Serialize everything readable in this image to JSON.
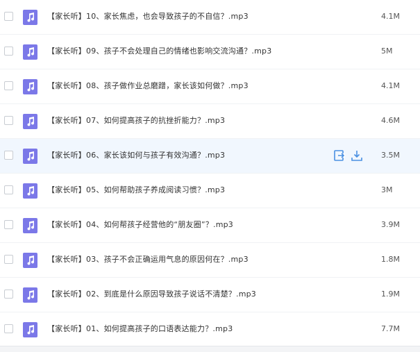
{
  "colors": {
    "file_icon_bg": "#7b78e8",
    "row_hover_bg": "#f1f7fe",
    "action_icon": "#4a90e2"
  },
  "files": [
    {
      "name": "【家长听】10、家长焦虑，也会导致孩子的不自信？.mp3",
      "size": "4.1M",
      "icon": "music-note-icon"
    },
    {
      "name": "【家长听】09、孩子不会处理自己的情绪也影响交流沟通？.mp3",
      "size": "5M",
      "icon": "music-note-icon"
    },
    {
      "name": "【家长听】08、孩子做作业总磨蹭，家长该如何做？.mp3",
      "size": "4.1M",
      "icon": "music-note-icon"
    },
    {
      "name": "【家长听】07、如何提高孩子的抗挫折能力？.mp3",
      "size": "4.6M",
      "icon": "music-note-icon"
    },
    {
      "name": "【家长听】06、家长该如何与孩子有效沟通？.mp3",
      "size": "3.5M",
      "icon": "music-note-icon",
      "hovered": true
    },
    {
      "name": "【家长听】05、如何帮助孩子养成阅读习惯？.mp3",
      "size": "3M",
      "icon": "music-note-icon"
    },
    {
      "name": "【家长听】04、如何帮孩子经营他的“朋友圈”？.mp3",
      "size": "3.9M",
      "icon": "music-note-icon"
    },
    {
      "name": "【家长听】03、孩子不会正确运用气息的原因何在？.mp3",
      "size": "1.8M",
      "icon": "music-note-icon"
    },
    {
      "name": "【家长听】02、到底是什么原因导致孩子说话不清楚？.mp3",
      "size": "1.9M",
      "icon": "music-note-icon"
    },
    {
      "name": "【家长听】01、如何提高孩子的口语表达能力？.mp3",
      "size": "7.7M",
      "icon": "music-note-icon"
    }
  ],
  "row_actions": [
    "share-icon",
    "download-icon"
  ]
}
